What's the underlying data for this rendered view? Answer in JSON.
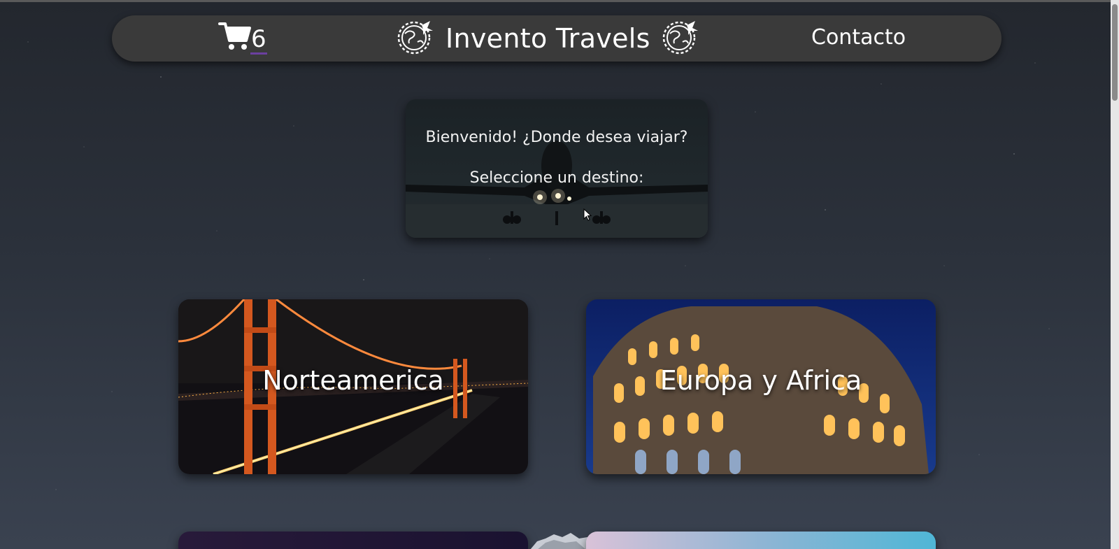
{
  "navbar": {
    "cart_count": "6",
    "brand_title": "Invento Travels",
    "contact_label": "Contacto",
    "icons": [
      "cart-icon",
      "globe-plane-icon",
      "globe-plane-icon"
    ]
  },
  "welcome": {
    "line1": "Bienvenido! ¿Donde desea viajar?",
    "line2": "Seleccione un destino:"
  },
  "destinations": [
    {
      "label": "Norteamerica"
    },
    {
      "label": "Europa y Africa"
    }
  ],
  "colors": {
    "navbar_bg": "#3a3a3a",
    "cart_underline": "#6b3fa0",
    "background": "#2b313b"
  }
}
